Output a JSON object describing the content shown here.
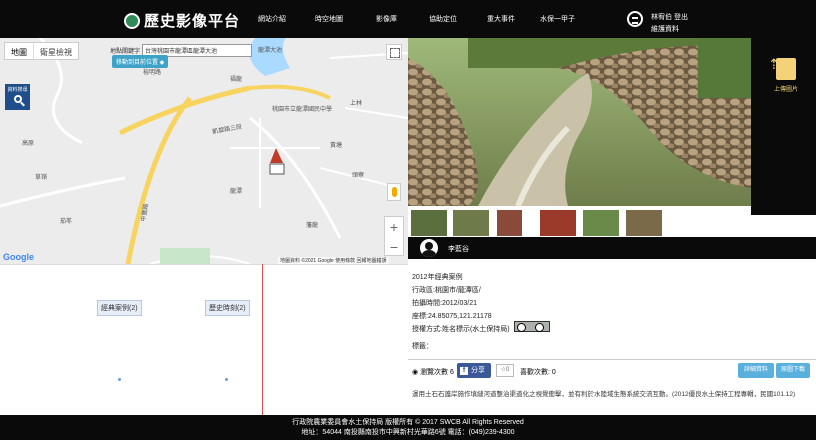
{
  "header": {
    "title": "歷史影像平台",
    "nav": [
      "網站介紹",
      "時空地圖",
      "影像庫",
      "協助定位",
      "重大事件",
      "水保一甲子"
    ],
    "user_line1": "林宥伯 登出",
    "user_line2": "維護資料"
  },
  "map": {
    "tab_map": "地圖",
    "tab_satellite": "衛星檢視",
    "location_label": "地點關鍵字",
    "location_value": "台灣桃園市龍潭區龍潭大池",
    "move_button": "移動到目前位置 ◆",
    "data_search": "資料搜尋",
    "labels": [
      "裕明路",
      "桃園市立龍潭國民中學",
      "龍潭大池",
      "福龍",
      "高原",
      "上林",
      "黃塘",
      "頭寮",
      "凱旋路三段",
      "中豐路",
      "龍潭",
      "草嶺",
      "茄苳",
      "藩龍"
    ],
    "google": "Google",
    "attribution": "地圖資料 ©2021 Google   使用條款   回報地圖錯誤",
    "zoom_in": "+",
    "zoom_out": "−"
  },
  "tags": {
    "classic": "經典案例(2)",
    "historical": "歷史時刻(2)"
  },
  "photo": {
    "upload_label": "上傳圖片"
  },
  "author": {
    "name": "李藍谷"
  },
  "info": {
    "title": "2012年經典案例",
    "district": "行政區:桃園市/龍潭區/",
    "date": "拍攝時間:2012/03/21",
    "coords": "座標:24.85075,121.21178",
    "license": "授權方式:姓名標示(水土保持局)",
    "tags_label": "標籤："
  },
  "stats": {
    "views": "瀏覽次數 6",
    "share": "分享",
    "like_count": "0",
    "likes": "喜歡次數: 0",
    "detail_button": "詳細資料",
    "download_button": "原圖下載"
  },
  "description": "運用土石石護岸施作填縫河道整治渠道化之視覺衝擊，並有利於水陸域生態系統交流互動。(2012優良水土保持工程專輯，民國101.12)",
  "footer": {
    "line1": "行政院農業委員會水土保持局 版權所有 © 2017 SWCB All Rights Reserved",
    "line2": "地址：54044 南投縣南投市中興新村光華路6號   電話：(049)239-4300"
  },
  "colors": {
    "header_bg": "#0a0a0a",
    "button_blue": "#5ab0dc",
    "facebook": "#3b5998",
    "upload_gold": "#f3d27a"
  }
}
